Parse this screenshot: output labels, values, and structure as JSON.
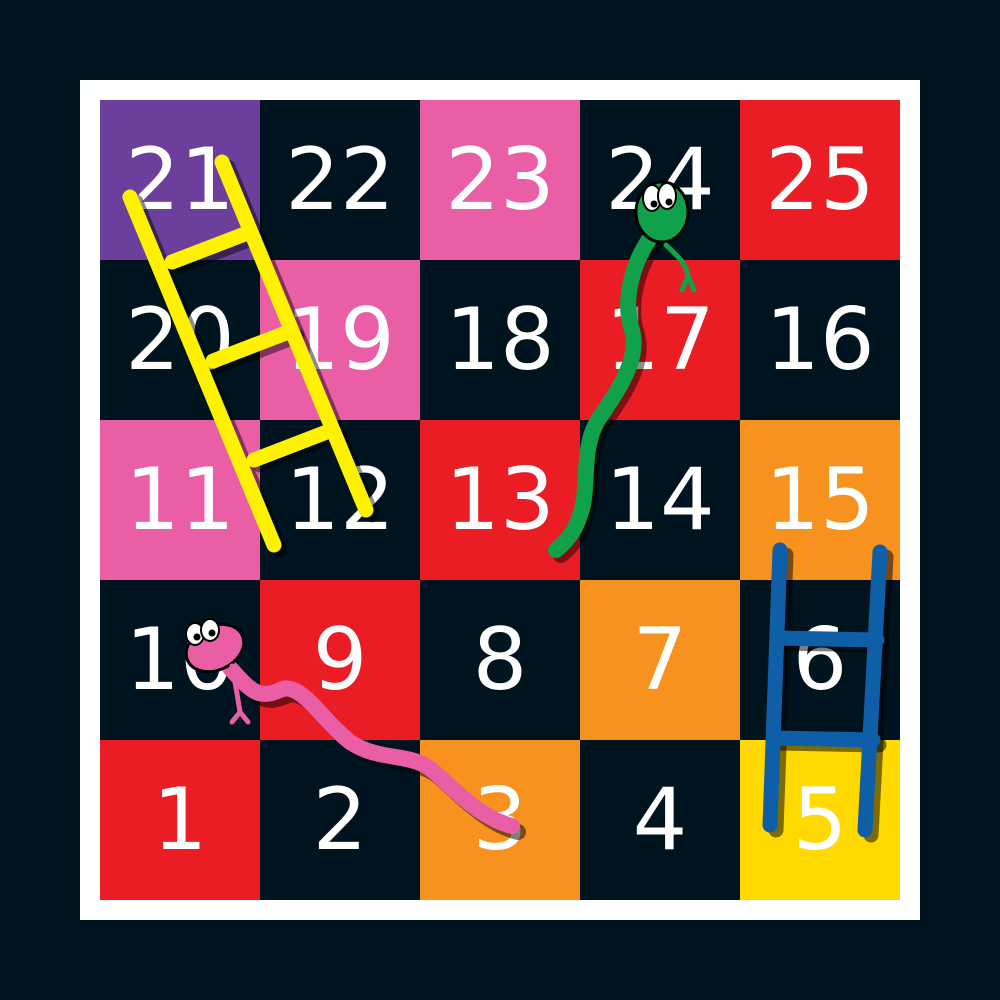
{
  "board": {
    "rows": [
      [
        {
          "number": "21",
          "color": "#6b3f9b"
        },
        {
          "number": "22",
          "color": "#001420"
        },
        {
          "number": "23",
          "color": "#ea5ea6"
        },
        {
          "number": "24",
          "color": "#001420"
        },
        {
          "number": "25",
          "color": "#ea1c24"
        }
      ],
      [
        {
          "number": "20",
          "color": "#001420"
        },
        {
          "number": "19",
          "color": "#ea5ea6"
        },
        {
          "number": "18",
          "color": "#001420"
        },
        {
          "number": "17",
          "color": "#ea1c24"
        },
        {
          "number": "16",
          "color": "#001420"
        }
      ],
      [
        {
          "number": "11",
          "color": "#ea5ea6"
        },
        {
          "number": "12",
          "color": "#001420"
        },
        {
          "number": "13",
          "color": "#ea1c24"
        },
        {
          "number": "14",
          "color": "#001420"
        },
        {
          "number": "15",
          "color": "#f7921e"
        }
      ],
      [
        {
          "number": "10",
          "color": "#001420"
        },
        {
          "number": "9",
          "color": "#ea1c24"
        },
        {
          "number": "8",
          "color": "#001420"
        },
        {
          "number": "7",
          "color": "#f7921e"
        },
        {
          "number": "6",
          "color": "#001420"
        }
      ],
      [
        {
          "number": "1",
          "color": "#ea1c24"
        },
        {
          "number": "2",
          "color": "#001420"
        },
        {
          "number": "3",
          "color": "#f7921e"
        },
        {
          "number": "4",
          "color": "#001420"
        },
        {
          "number": "5",
          "color": "#ffd900"
        }
      ]
    ]
  },
  "pieces": {
    "yellow_ladder": {
      "color": "#fff200",
      "from_square": "12",
      "to_square": "21"
    },
    "blue_ladder": {
      "color": "#0f5fa8",
      "from_square": "5",
      "to_square": "15"
    },
    "green_snake": {
      "color": "#11a14a",
      "head_square": "24",
      "tail_square": "13"
    },
    "pink_snake": {
      "color": "#ea5ea6",
      "head_square": "10",
      "tail_square": "3"
    }
  },
  "colors": {
    "background": "#001420",
    "frame": "#ffffff",
    "number_text": "#ffffff"
  }
}
